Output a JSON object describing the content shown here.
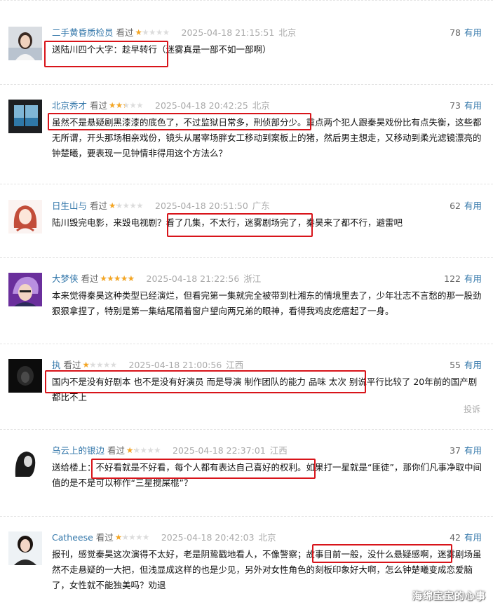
{
  "comments": [
    {
      "user": "二手黄昏质检员",
      "status": "看过",
      "rating": 1,
      "time": "2025-04-18 21:15:51",
      "location": "北京",
      "votes": "78",
      "useful_label": "有用",
      "text": "送陆川四个大字：趁早转行（迷雾真是一部不如一部啊）",
      "avatar_icon": "woman-portrait-avatar"
    },
    {
      "user": "北京秀才",
      "status": "看过",
      "rating": 2,
      "time": "2025-04-18 20:42:25",
      "location": "北京",
      "votes": "73",
      "useful_label": "有用",
      "text": "虽然不是悬疑剧黑漆漆的底色了，不过监狱日常多，刑侦部分少。重点两个犯人跟秦昊戏份比有点失衡，这些都无所谓，开头那场相亲戏份，镜头从屠宰场胖女工移动到案板上的猪，然后男主想走，又移动到柔光滤镜漂亮的钟楚曦，要表现一见钟情非得用这个方法么？",
      "avatar_icon": "ocean-window-avatar"
    },
    {
      "user": "日生山与",
      "status": "看过",
      "rating": 1,
      "time": "2025-04-18 20:51:50",
      "location": "广东",
      "votes": "62",
      "useful_label": "有用",
      "text": "陆川毁完电影，来毁电视剧？看了几集，不太行，迷雾剧场完了，秦昊来了都不行，避雷吧",
      "avatar_icon": "illustrated-girl-avatar"
    },
    {
      "user": "大梦侠",
      "status": "看过",
      "rating": 5,
      "time": "2025-04-18 21:22:56",
      "location": "浙江",
      "votes": "122",
      "useful_label": "有用",
      "text": "本来觉得秦昊这种类型已经演烂，但看完第一集就完全被带到杜湘东的情境里去了，少年壮志不言愁的那一股劲狠狠拿捏了，特别是第一集结尾隔着窗户望向两兄弟的眼神，看得我鸡皮疙瘩起了一身。",
      "avatar_icon": "anime-character-avatar"
    },
    {
      "user": "执",
      "status": "看过",
      "rating": 1,
      "time": "2025-04-18 21:00:56",
      "location": "江西",
      "votes": "55",
      "useful_label": "有用",
      "text": "国内不是没有好剧本 也不是没有好演员 而是导演 制作团队的能力 品味 太次 别说平行比较了 20年前的国产剧都比不上",
      "report_label": "投诉",
      "avatar_icon": "dark-silhouette-avatar"
    },
    {
      "user": "乌云上的银边",
      "status": "看过",
      "rating": 1,
      "time": "2025-04-18 22:37:01",
      "location": "江西",
      "votes": "37",
      "useful_label": "有用",
      "text": "送给楼上：不好看就是不好看，每个人都有表达自己喜好的权利。如果打一星就是“匪徒”，那你们凡事净取中间值的是不是可以称作“三星搅屎棍”？",
      "avatar_icon": "sketch-woman-avatar"
    },
    {
      "user": "Catheese",
      "status": "看过",
      "rating": 1,
      "time": "2025-04-18 20:42:03",
      "location": "北京",
      "votes": "42",
      "useful_label": "有用",
      "text": "报刊，感觉秦昊这次演得不太好，老是阴鸷戳地看人，不像警察；故事目前一般，没什么悬疑感啊，迷雾剧场虽然不走悬疑的一大把，但浅显成这样的也是少见，另外对女性角色的刻板印象好大啊，怎么钟楚曦变成恋爱脑了，女性就不能独美吗？劝退",
      "avatar_icon": "girl-photo-avatar"
    }
  ],
  "watermark": "海绵宝宝的心事",
  "colors": {
    "link": "#3377aa",
    "star": "#f5a623",
    "highlight": "#d8141a",
    "meta_gray": "#aaaaaa"
  }
}
